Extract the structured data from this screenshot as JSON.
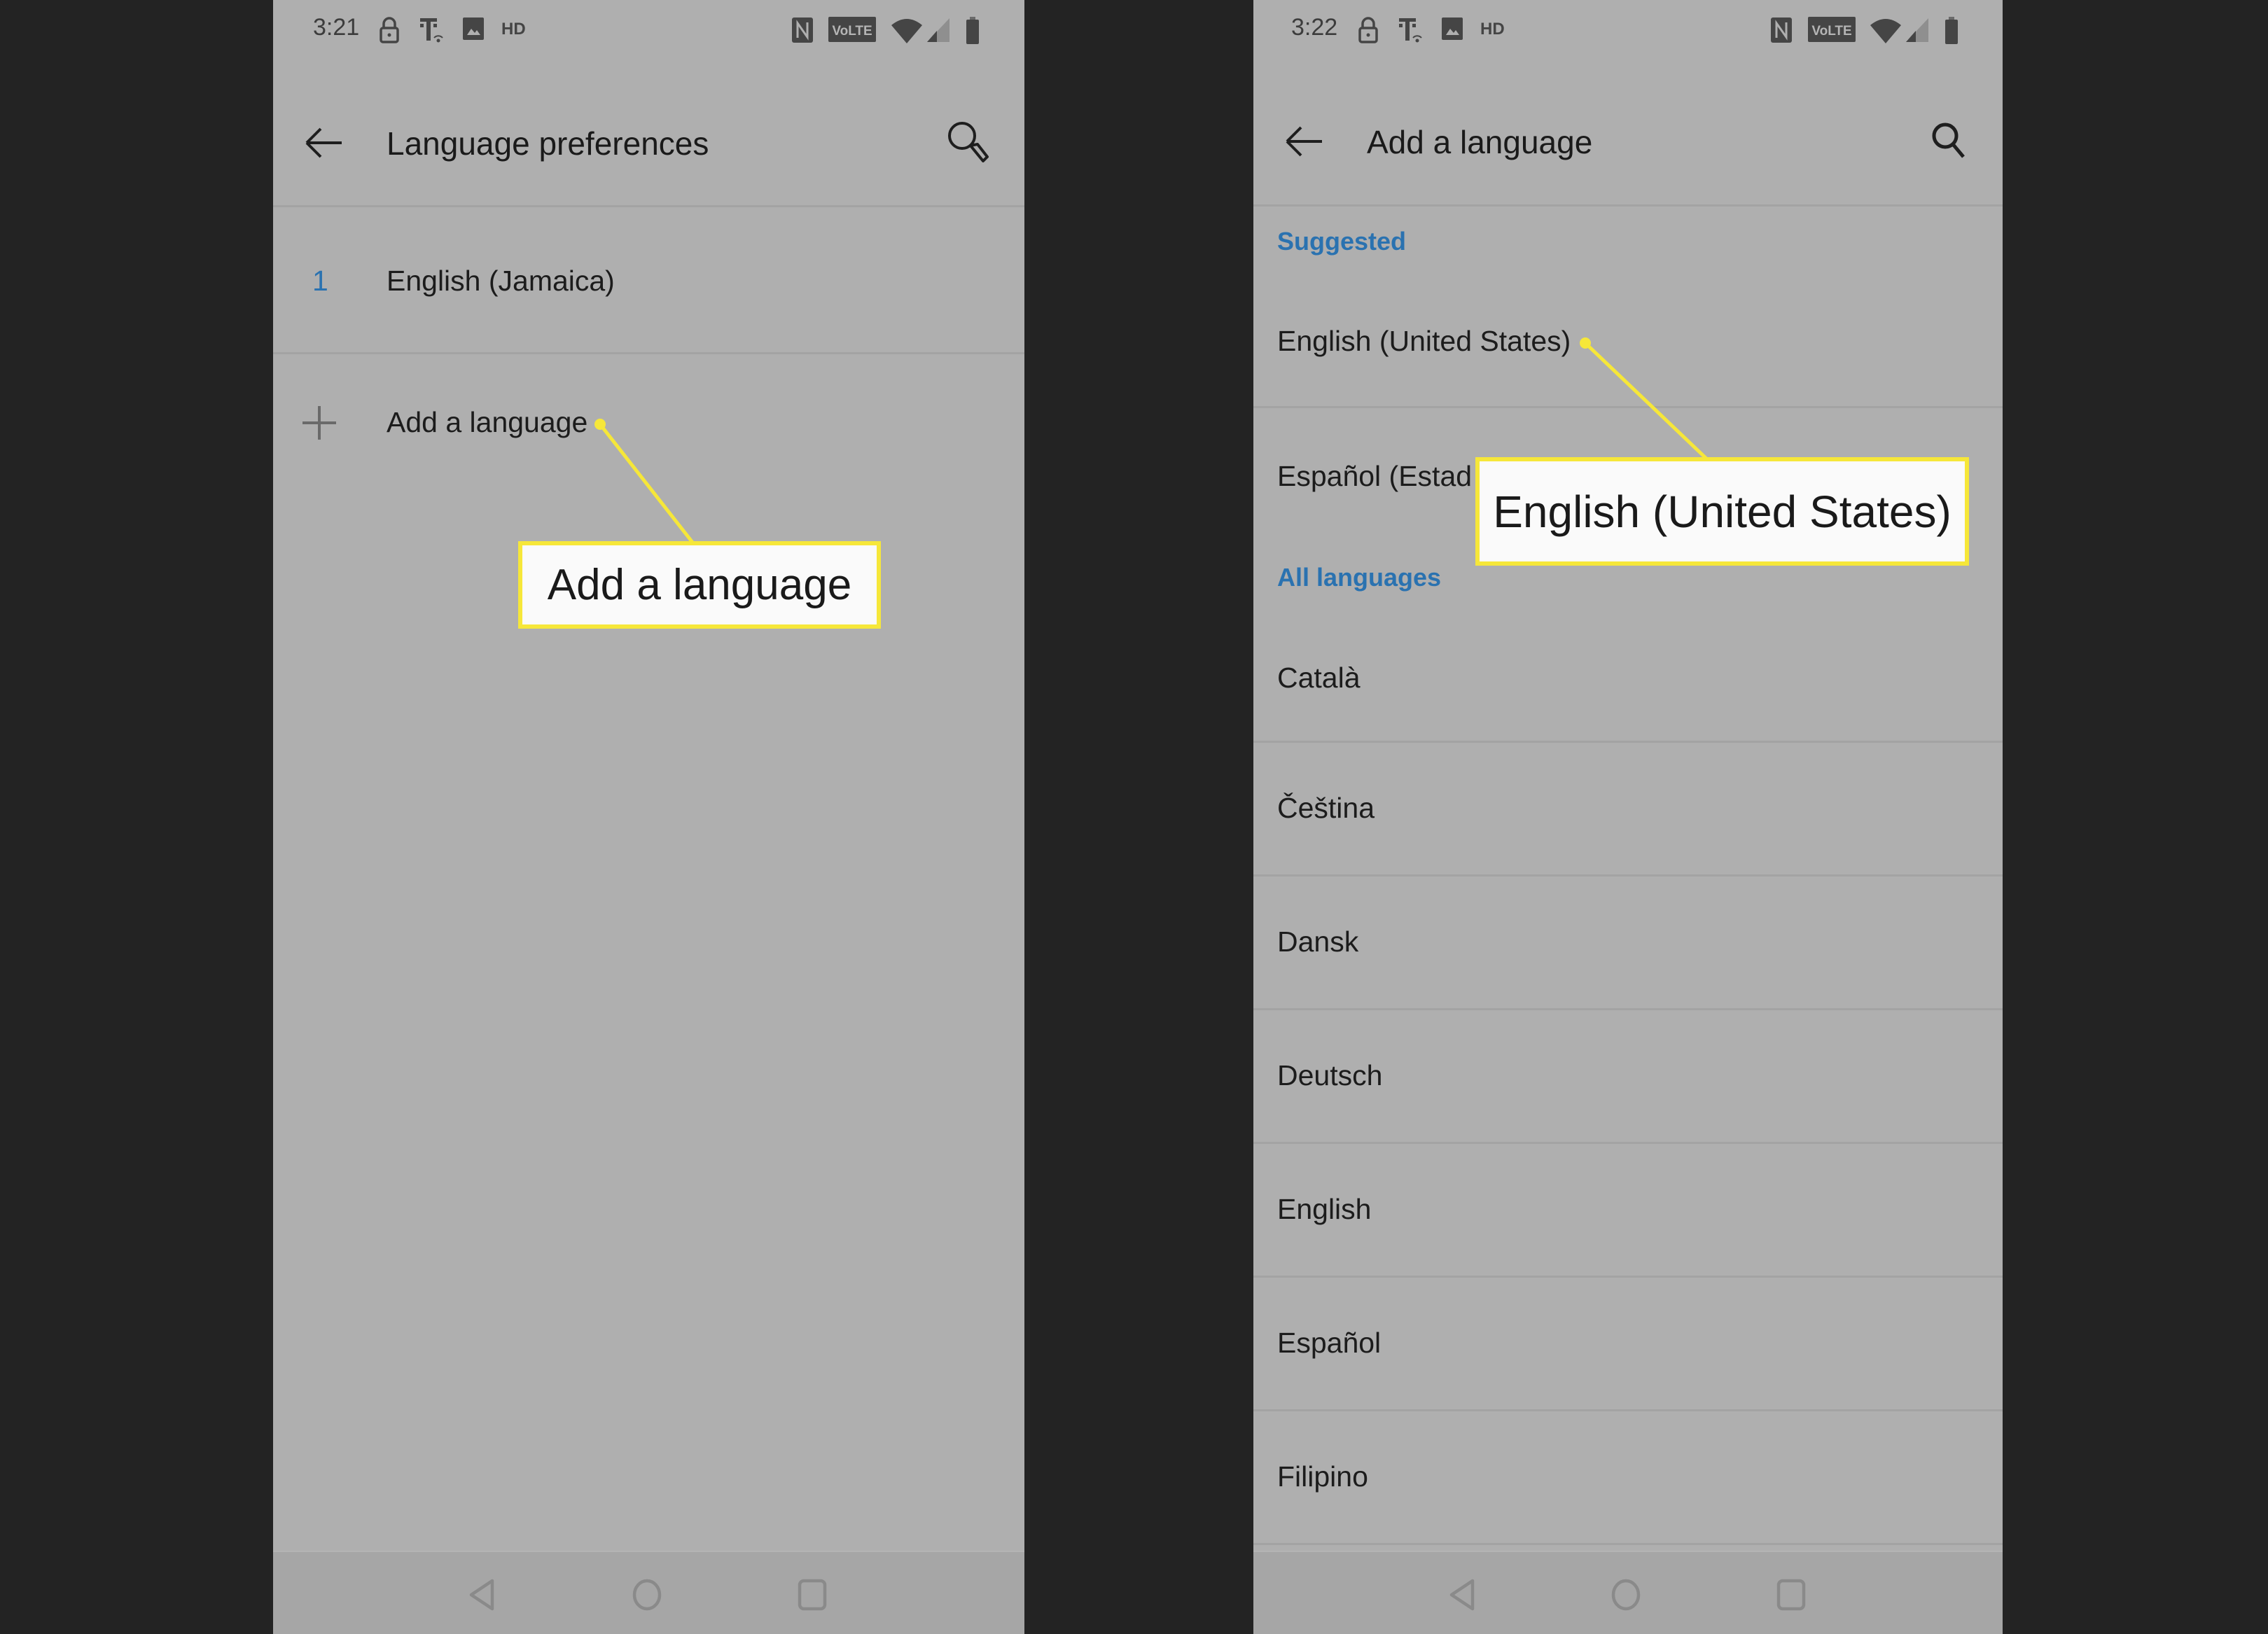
{
  "screens": {
    "left": {
      "status_bar": {
        "time": "3:21",
        "left_icons": [
          "lock-icon",
          "t-mobile-wifi-calling-icon",
          "image-icon",
          "hd-voice-icon"
        ],
        "right_icons": [
          "nfc-icon",
          "volte-icon",
          "wifi-icon",
          "cell-signal-icon",
          "battery-icon"
        ],
        "volte_label": "VoLTE",
        "hd_label": "HD"
      },
      "toolbar": {
        "back_icon": "back-arrow-icon",
        "title": "Language preferences",
        "search_icon": "search-icon"
      },
      "languages": [
        {
          "rank": "1",
          "name": "English (Jamaica)"
        }
      ],
      "add_language": {
        "icon": "plus-icon",
        "label": "Add a language"
      },
      "callout": {
        "text": "Add a language"
      },
      "navbar": {
        "icons": [
          "nav-back-icon",
          "nav-home-icon",
          "nav-recents-icon"
        ]
      }
    },
    "right": {
      "status_bar": {
        "time": "3:22",
        "left_icons": [
          "lock-icon",
          "t-mobile-wifi-calling-icon",
          "image-icon",
          "hd-voice-icon"
        ],
        "right_icons": [
          "nfc-icon",
          "volte-icon",
          "wifi-icon",
          "cell-signal-icon",
          "battery-icon"
        ],
        "volte_label": "VoLTE",
        "hd_label": "HD"
      },
      "toolbar": {
        "back_icon": "back-arrow-icon",
        "title": "Add a language",
        "search_icon": "search-icon"
      },
      "suggested": {
        "label": "Suggested",
        "items": [
          "English (United States)",
          "Español (Estad"
        ]
      },
      "all_languages": {
        "label": "All languages",
        "items": [
          "Català",
          "Čeština",
          "Dansk",
          "Deutsch",
          "English",
          "Español",
          "Filipino"
        ]
      },
      "callout": {
        "text": "English (United States)"
      },
      "navbar": {
        "icons": [
          "nav-back-icon",
          "nav-home-icon",
          "nav-recents-icon"
        ]
      }
    }
  },
  "colors": {
    "background": "#232323",
    "screen": "#afafaf",
    "accent_blue": "#2a72b0",
    "callout_border": "#f6e739",
    "callout_fill": "#fafafa"
  }
}
